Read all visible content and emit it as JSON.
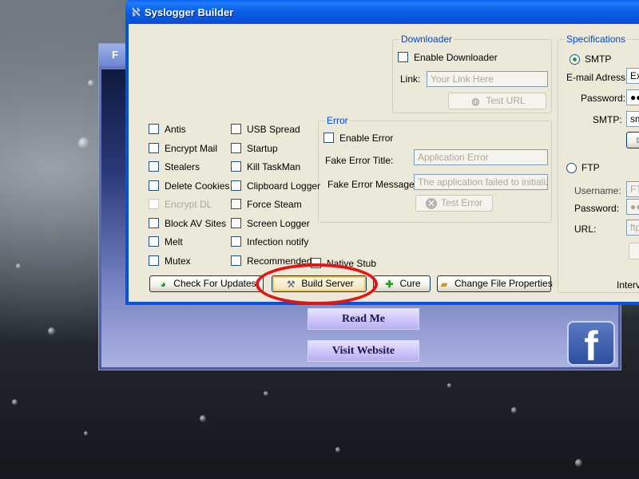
{
  "back_window": {
    "title": "F",
    "buttons": {
      "read_me": "Read Me",
      "visit_website": "Visit Website"
    },
    "fb_letter": "f"
  },
  "window": {
    "title": "Syslogger Builder",
    "title_color": "#0054e3",
    "client_color": "#ece9d8"
  },
  "checkboxes": {
    "col1": [
      "Antis",
      "Encrypt Mail",
      "Stealers",
      "Delete Cookies",
      "Encrypt DL",
      "Block AV Sites",
      "Melt",
      "Mutex"
    ],
    "col1_disabled": [
      "Encrypt DL"
    ],
    "col2": [
      "USB Spread",
      "Startup",
      "Kill TaskMan",
      "Clipboard Logger",
      "Force Steam",
      "Screen Logger",
      "Infection notify",
      "Recommended"
    ],
    "native_stub": "Native Stub"
  },
  "downloader": {
    "group_label": "Downloader",
    "enable_label": "Enable Downloader",
    "link_label": "Link:",
    "link_placeholder": "Your Link Here",
    "test_url_button": "Test URL"
  },
  "error": {
    "group_label": "Error",
    "enable_label": "Enable Error",
    "fake_title_label": "Fake Error Title:",
    "fake_title_value": "Application Error",
    "fake_message_label": "Fake Error Message:",
    "fake_message_value": "The application failed to initialize p",
    "test_error_button": "Test Error"
  },
  "specs": {
    "group_label": "Specifications",
    "smtp_label": "SMTP",
    "smtp_selected": true,
    "email_label": "E-mail Adress:",
    "email_value": "Ex",
    "password_label": "Password:",
    "password_value": "●●",
    "smtp_field_label": "SMTP:",
    "smtp_value": "sm",
    "ftp_label": "FTP",
    "ftp_username_label": "Username:",
    "ftp_username_value": "FT",
    "ftp_password_label": "Password:",
    "ftp_password_value": "●●",
    "url_label": "URL:",
    "url_value": "ftp",
    "interval_label": "Interv"
  },
  "bottom_buttons": {
    "check_updates": "Check For Updates",
    "build_server": "Build Server",
    "cure": "Cure",
    "change_file_properties": "Change File Properties"
  },
  "annotation_color": "#e41414"
}
